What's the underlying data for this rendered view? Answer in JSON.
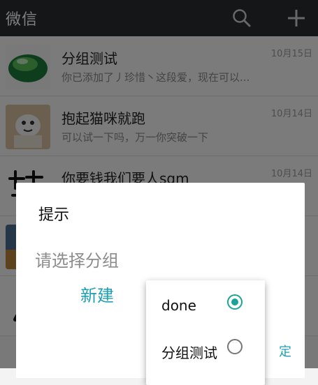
{
  "header": {
    "title": "微信",
    "icons": [
      "search-icon",
      "plus-icon"
    ]
  },
  "chats": [
    {
      "name": "分组测试",
      "time": "10月15日",
      "preview": "你已添加了丿珍惜丶这段爱，现在可以..."
    },
    {
      "name": "抱起猫咪就跑",
      "time": "10月14日",
      "preview": "可以试一下吗，万一你突破一下"
    },
    {
      "name": "你要钱我们要人sqm",
      "time": "10月14日",
      "preview": ""
    },
    {
      "name": "",
      "time": "",
      "preview": ""
    },
    {
      "name": "",
      "time": "",
      "preview": ""
    }
  ],
  "dialog": {
    "title": "提示",
    "message": "请选择分组",
    "new_label": "新建",
    "ok_label": "定"
  },
  "popup": {
    "options": [
      {
        "label": "done",
        "selected": true
      },
      {
        "label": "分组测试",
        "selected": false
      }
    ]
  },
  "colors": {
    "accent": "#1aa39b",
    "link": "#1ea0b4",
    "topbar": "#2a2d30"
  }
}
